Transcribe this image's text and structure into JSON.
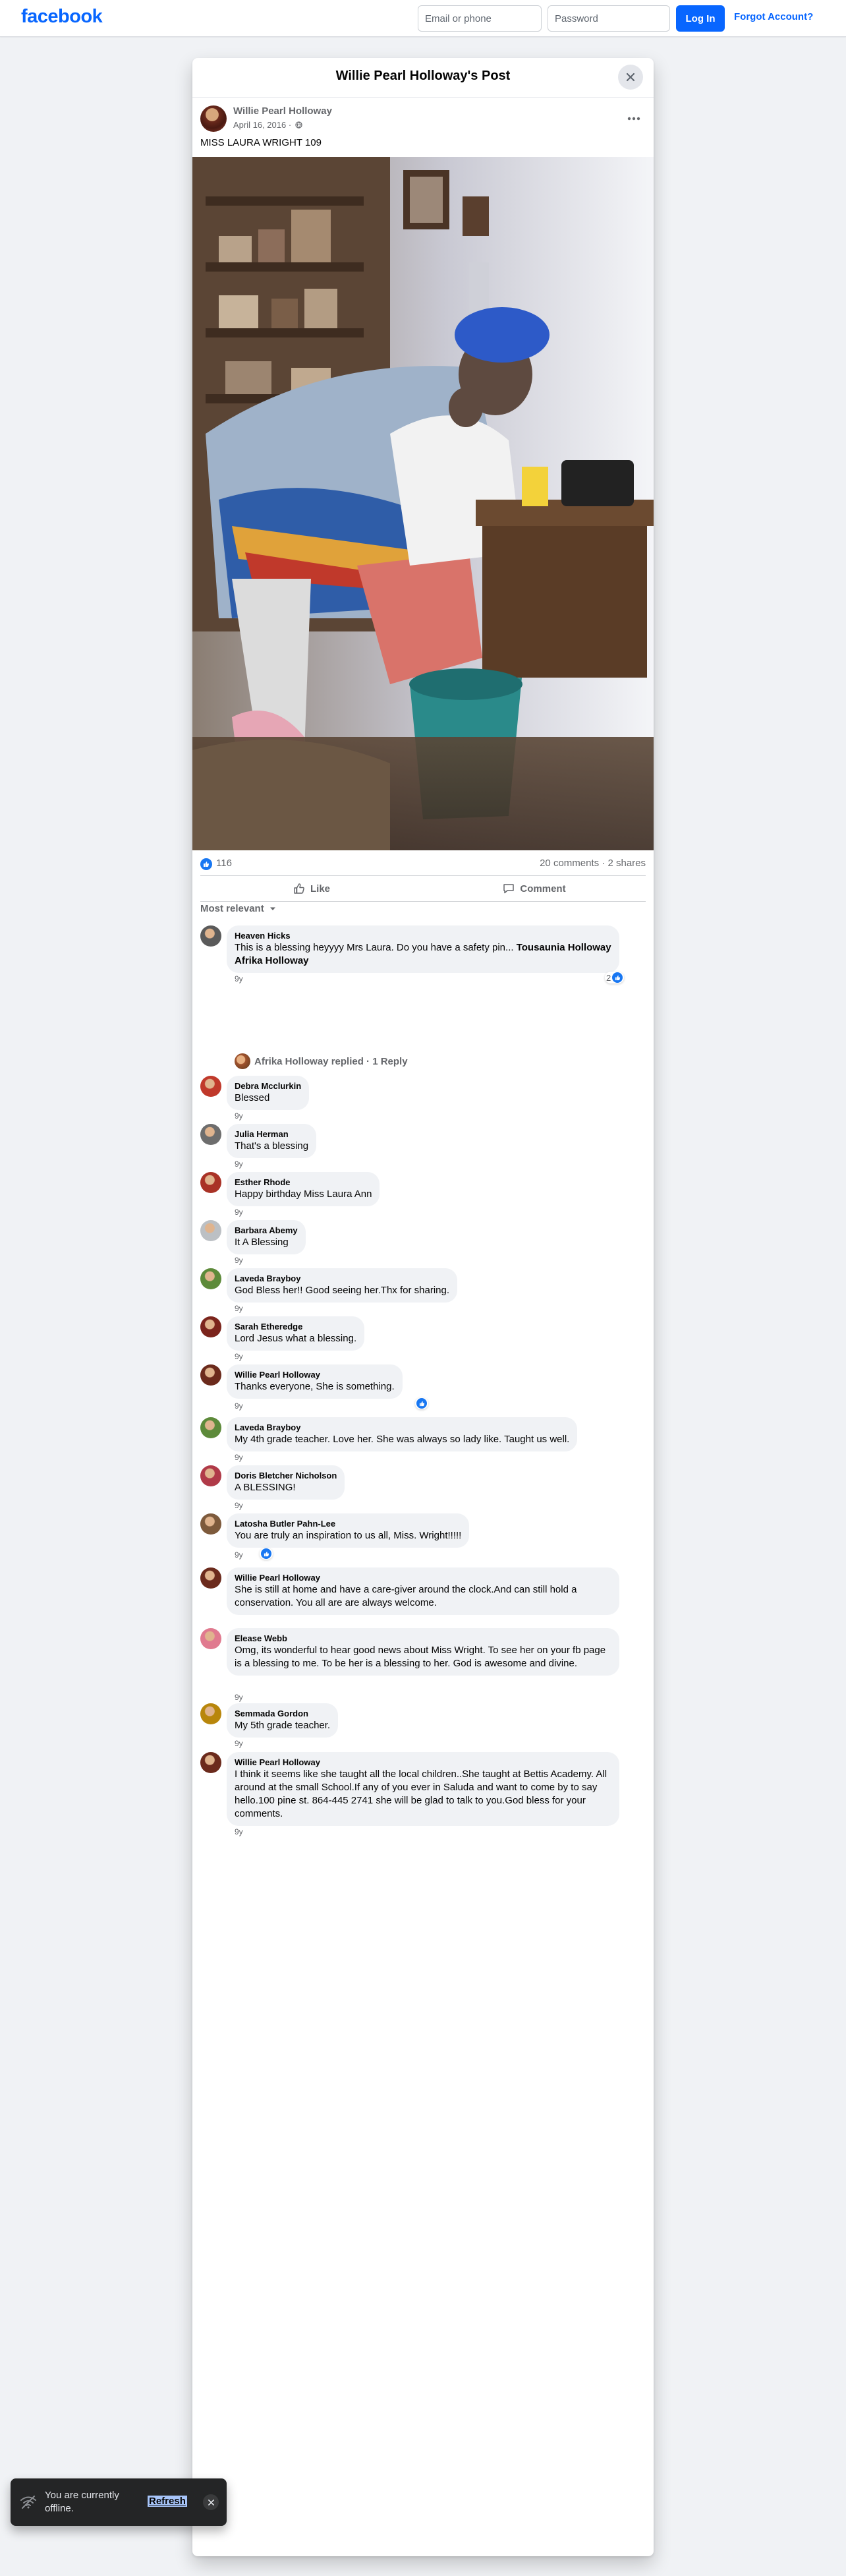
{
  "header": {
    "logo": "facebook",
    "email_placeholder": "Email or phone",
    "password_placeholder": "Password",
    "login_label": "Log In",
    "forgot_label": "Forgot Account?"
  },
  "post": {
    "modal_title": "Willie Pearl Holloway's Post",
    "author": "Willie Pearl Holloway",
    "date": "April 16, 2016 ·",
    "text": "MISS LAURA WRIGHT 109",
    "like_count": "116",
    "comments_shares": "20 comments · 2 shares",
    "like_action": "Like",
    "comment_action": "Comment",
    "sort_label": "Most relevant"
  },
  "comments": [
    {
      "name": "Heaven Hicks",
      "text": "This is a blessing heyyyy Mrs Laura. Do you have a safety pin... ",
      "tags": "Tousaunia Holloway Afrika Holloway",
      "time": "9y",
      "reactions": "2",
      "avatar_color": "#5a5a5a"
    },
    {
      "name": "Debra Mcclurkin",
      "text": "Blessed",
      "time": "9y",
      "avatar_color": "#c0392b"
    },
    {
      "name": "Julia Herman",
      "text": "That's a blessing",
      "time": "9y",
      "avatar_color": "#6d6d6d"
    },
    {
      "name": "Esther Rhode",
      "text": "Happy birthday Miss Laura Ann",
      "time": "9y",
      "avatar_color": "#a93226"
    },
    {
      "name": "Barbara Abemy",
      "text": "It A Blessing",
      "time": "9y",
      "avatar_color": "#bcc0c4"
    },
    {
      "name": "Laveda Brayboy",
      "text": "God Bless her!! Good seeing her.Thx for sharing.",
      "time": "9y",
      "avatar_color": "#5d8a3a"
    },
    {
      "name": "Sarah Etheredge",
      "text": "Lord Jesus what a blessing.",
      "time": "9y",
      "avatar_color": "#7b241c"
    },
    {
      "name": "Willie Pearl Holloway",
      "text": "Thanks everyone, She is something.",
      "time": "9y",
      "avatar_color": "#6b2a1c"
    },
    {
      "name": "Laveda Brayboy",
      "text": "My 4th grade teacher. Love her. She was always so lady like. Taught us well.",
      "time": "9y",
      "avatar_color": "#5d8a3a"
    },
    {
      "name": "Doris Bletcher Nicholson",
      "text": "A BLESSING!",
      "time": "9y",
      "avatar_color": "#b03a48"
    },
    {
      "name": "Latosha Butler Pahn-Lee",
      "text": "You are truly an inspiration to us all, Miss. Wright!!!!!",
      "time": "9y",
      "avatar_color": "#7d5a3c"
    },
    {
      "name": "Willie Pearl Holloway",
      "text": "She is still at home and have a care-giver around the clock.And can still hold a conservation. You all are are always welcome.",
      "time": "",
      "avatar_color": "#6b2a1c"
    },
    {
      "name": "Elease Webb",
      "text": "Omg, its wonderful to hear good news about Miss Wright. To see her on your fb page is a blessing to me. To be her is a blessing to her. God is awesome and divine.",
      "time": "9y",
      "avatar_color": "#e07a8f"
    },
    {
      "name": "Semmada Gordon",
      "text": "My 5th grade teacher.",
      "time": "9y",
      "avatar_color": "#b8860b"
    },
    {
      "name": "Willie Pearl Holloway",
      "text": "I think it seems like she taught all the local children..She taught at Bettis Academy. All around at the small School.If any of you ever in Saluda and want to come by to say hello.100 pine st. 864-445 2741 she will be glad to talk to you.God bless for your comments.",
      "time": "9y",
      "avatar_color": "#6b2a1c"
    }
  ],
  "reply_summary": "Afrika Holloway replied · 1 Reply",
  "toast": {
    "text": "You are currently offline.",
    "refresh": "Refresh"
  }
}
